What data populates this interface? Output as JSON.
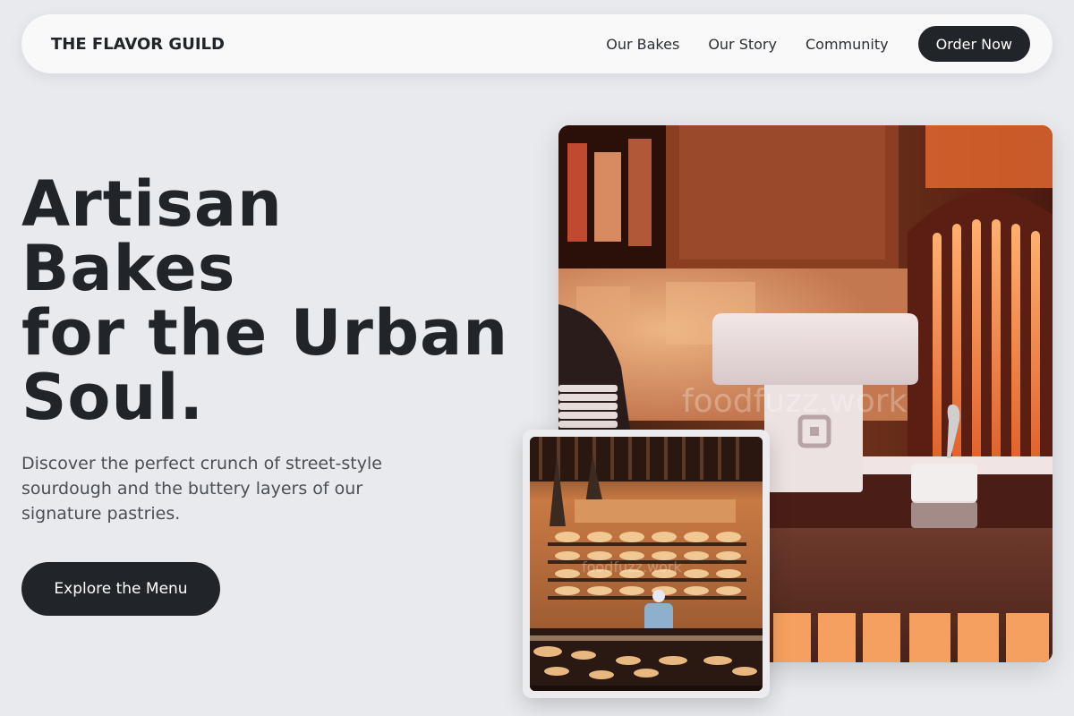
{
  "nav": {
    "logo": "THE FLAVOR GUILD",
    "links": [
      "Our Bakes",
      "Our Story",
      "Community"
    ],
    "cta_label": "Order Now"
  },
  "hero": {
    "title_lines": [
      "Artisan",
      "Bakes",
      "for the Urban",
      "Soul."
    ],
    "description": "Discover the perfect crunch of street-style sourdough and the buttery layers of our signature pastries.",
    "cta_label": "Explore the Menu"
  },
  "images": {
    "main_watermark": "foodfuzz.work",
    "secondary_watermark": "foodfuzz.work"
  },
  "colors": {
    "background": "#e8eaee",
    "primary_dark": "#212428",
    "nav_background": "#f9f9fa"
  }
}
